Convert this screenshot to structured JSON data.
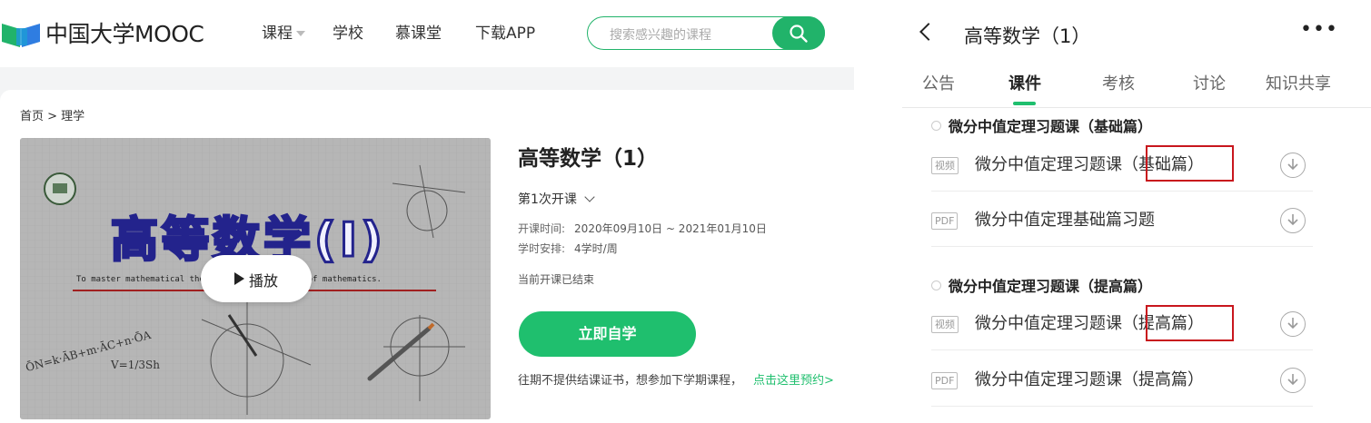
{
  "web": {
    "logo_text": "中国大学MOOC",
    "nav": [
      "课程",
      "学校",
      "慕课堂",
      "下载APP"
    ],
    "search_placeholder": "搜索感兴趣的课程",
    "breadcrumb": "首页 > 理学",
    "video": {
      "title_art": "高等数学(I)",
      "subtitle_line": "To master mathematical thought and the essence of mathematics.",
      "play_label": "播放",
      "formula_1": "ŌN=k·ĀB+m·ĀC+n·ŌA",
      "formula_2": "V=1/3Sh"
    },
    "course_title": "高等数学（1）",
    "session": "第1次开课",
    "schedule": {
      "time_label": "开课时间:",
      "time_value": "2020年09月10日 ~ 2021年01月10日",
      "hours_label": "学时安排:",
      "hours_value": "4学时/周"
    },
    "status": "当前开课已结束",
    "enroll_button": "立即自学",
    "note": "往期不提供结课证书，想参加下学期课程，",
    "note_link": "点击这里预约>"
  },
  "app": {
    "title": "高等数学（1）",
    "more": "•••",
    "tabs": [
      "公告",
      "课件",
      "考核",
      "讨论",
      "知识共享"
    ],
    "active_tab": 1,
    "sections": [
      {
        "title": "微分中值定理习题课（基础篇）",
        "items": [
          {
            "badge": "视频",
            "name": "微分中值定理习题课（基础篇）"
          },
          {
            "badge": "PDF",
            "name": "微分中值定理基础篇习题"
          }
        ]
      },
      {
        "title": "微分中值定理习题课（提高篇）",
        "items": [
          {
            "badge": "视频",
            "name": "微分中值定理习题课（提高篇）"
          },
          {
            "badge": "PDF",
            "name": "微分中值定理习题课（提高篇）"
          }
        ]
      }
    ]
  },
  "colors": {
    "brand_green": "#1fbf6e",
    "highlight_red": "#c8161d"
  }
}
